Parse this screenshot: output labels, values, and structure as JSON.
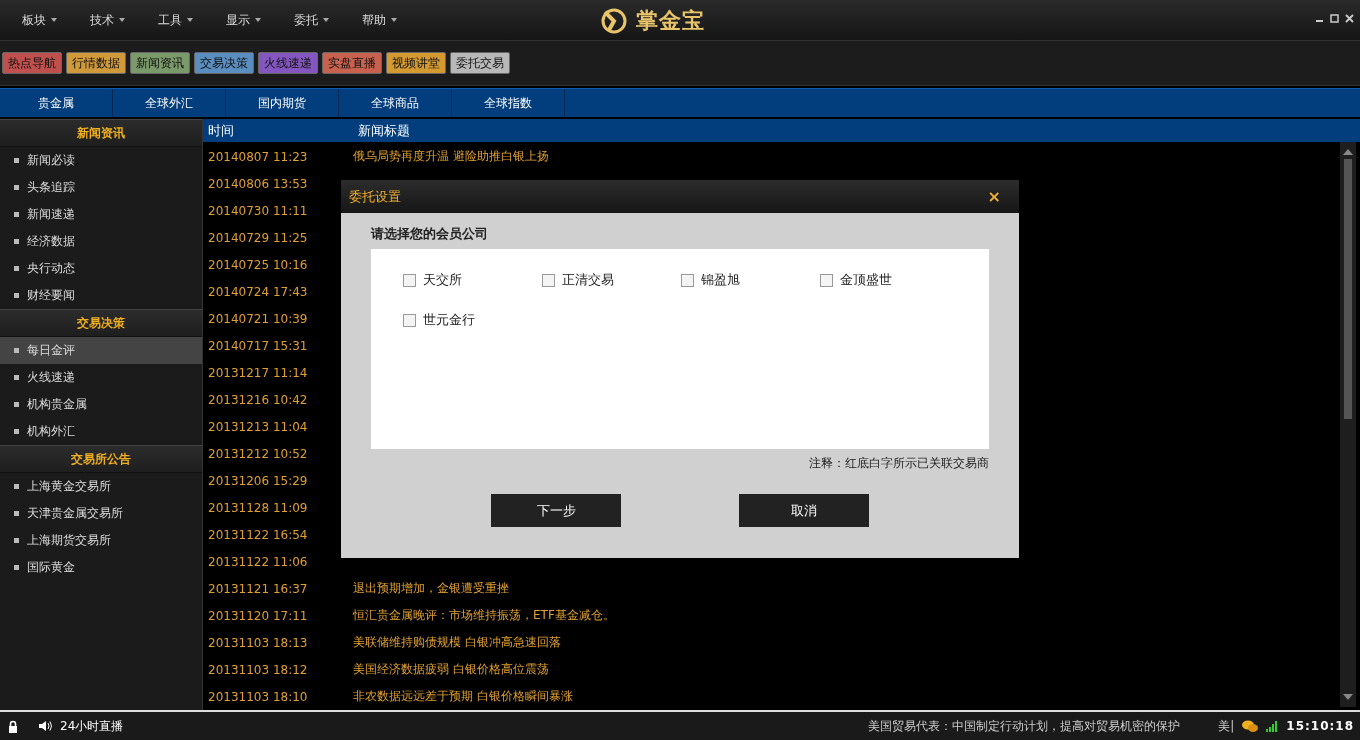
{
  "menu": [
    {
      "label": "板块"
    },
    {
      "label": "技术"
    },
    {
      "label": "工具"
    },
    {
      "label": "显示"
    },
    {
      "label": "委托"
    },
    {
      "label": "帮助"
    }
  ],
  "app_title": "掌金宝",
  "toolbar": [
    {
      "label": "热点导航",
      "color": "#c0504d"
    },
    {
      "label": "行情数据",
      "color": "#d09a3a"
    },
    {
      "label": "新闻资讯",
      "color": "#7b9a6a"
    },
    {
      "label": "交易决策",
      "color": "#5b8ec0"
    },
    {
      "label": "火线速递",
      "color": "#8457c0"
    },
    {
      "label": "实盘直播",
      "color": "#c8614e"
    },
    {
      "label": "视频讲堂",
      "color": "#d49a30"
    },
    {
      "label": "委托交易",
      "color": "#b8b8b8"
    }
  ],
  "market_tabs": [
    {
      "label": "贵金属",
      "selected": false
    },
    {
      "label": "全球外汇",
      "selected": false
    },
    {
      "label": "国内期货",
      "selected": false
    },
    {
      "label": "全球商品",
      "selected": false
    },
    {
      "label": "全球指数",
      "selected": false
    }
  ],
  "sidebar": [
    {
      "title": "新闻资讯",
      "items": [
        {
          "label": "新闻必读",
          "selected": false
        },
        {
          "label": "头条追踪",
          "selected": false
        },
        {
          "label": "新闻速递",
          "selected": false
        },
        {
          "label": "经济数据",
          "selected": false
        },
        {
          "label": "央行动态",
          "selected": false
        },
        {
          "label": "财经要闻",
          "selected": false
        }
      ]
    },
    {
      "title": "交易决策",
      "items": [
        {
          "label": "每日金评",
          "selected": true
        },
        {
          "label": "火线速递",
          "selected": false
        },
        {
          "label": "机构贵金属",
          "selected": false
        },
        {
          "label": "机构外汇",
          "selected": false
        }
      ]
    },
    {
      "title": "交易所公告",
      "items": [
        {
          "label": "上海黄金交易所",
          "selected": false
        },
        {
          "label": "天津贵金属交易所",
          "selected": false
        },
        {
          "label": "上海期货交易所",
          "selected": false
        },
        {
          "label": "国际黄金",
          "selected": false
        }
      ]
    }
  ],
  "news_table": {
    "columns": [
      "时间",
      "新闻标题"
    ],
    "rows": [
      {
        "time": "20140807 11:23",
        "title": "俄乌局势再度升温 避险助推白银上扬"
      },
      {
        "time": "20140806 13:53"
      },
      {
        "time": "20140730 11:11"
      },
      {
        "time": "20140729 11:25"
      },
      {
        "time": "20140725 10:16"
      },
      {
        "time": "20140724 17:43"
      },
      {
        "time": "20140721 10:39"
      },
      {
        "time": "20140717 15:31"
      },
      {
        "time": "20131217 11:14"
      },
      {
        "time": "20131216 10:42"
      },
      {
        "time": "20131213 11:04"
      },
      {
        "time": "20131212 10:52"
      },
      {
        "time": "20131206 15:29"
      },
      {
        "time": "20131128 11:09"
      },
      {
        "time": "20131122 16:54"
      },
      {
        "time": "20131122 11:06"
      },
      {
        "time": "20131121 16:37",
        "title": "退出预期增加，金银遭受重挫"
      },
      {
        "time": "20131120 17:11",
        "title": "恒汇贵金属晚评：市场维持振荡，ETF基金减仓。"
      },
      {
        "time": "20131103 18:13",
        "title": "美联储维持购债规模 白银冲高急速回落"
      },
      {
        "time": "20131103 18:12",
        "title": "美国经济数据疲弱 白银价格高位震荡"
      },
      {
        "time": "20131103 18:10",
        "title": "非农数据远远差于预期 白银价格瞬间暴涨"
      }
    ]
  },
  "dialog": {
    "title": "委托设置",
    "close": "×",
    "prompt": "请选择您的会员公司",
    "options": [
      {
        "label": "天交所",
        "checked": false
      },
      {
        "label": "正清交易",
        "checked": false
      },
      {
        "label": "锦盈旭",
        "checked": false
      },
      {
        "label": "金顶盛世",
        "checked": false
      },
      {
        "label": "世元金行",
        "checked": false
      }
    ],
    "note": "注释：红底白字所示已关联交易商",
    "buttons": [
      "下一步",
      "取消"
    ]
  },
  "status_bar": {
    "live": "24小时直播",
    "ticker": "美国贸易代表：中国制定行动计划，提高对贸易机密的保护",
    "ticker_2": "美|",
    "time": "15:10:18"
  }
}
